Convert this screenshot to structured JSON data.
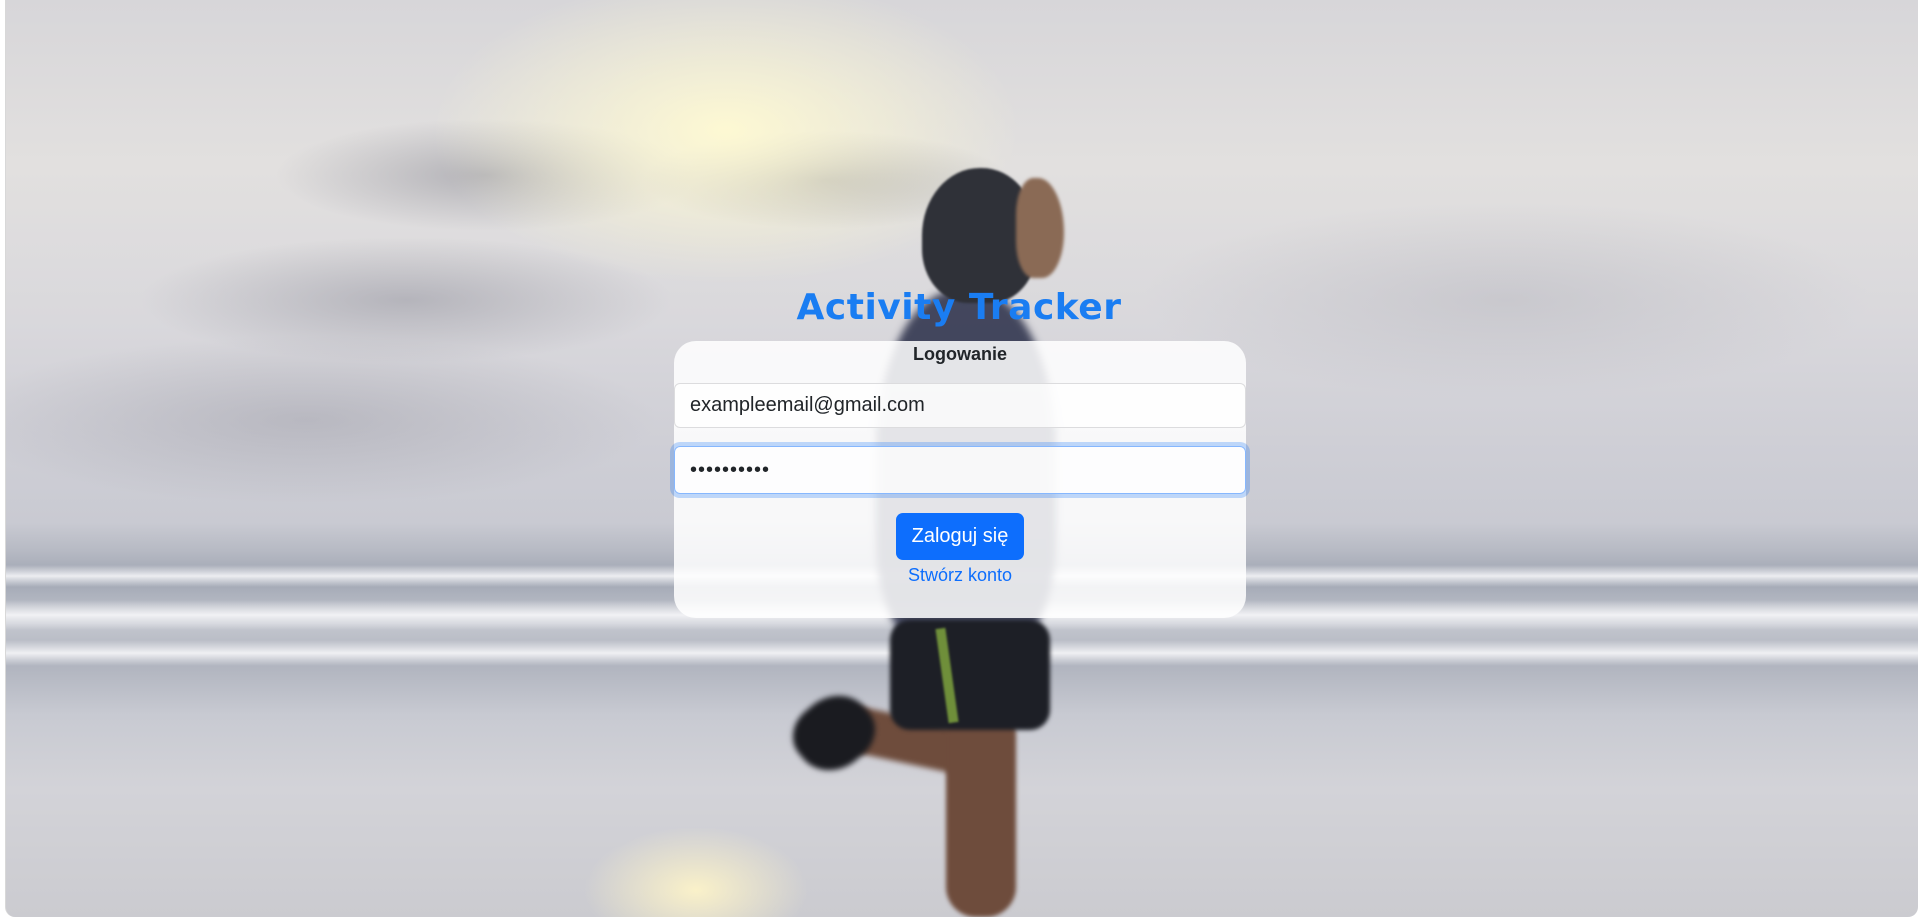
{
  "app": {
    "title": "Activity Tracker"
  },
  "login_card": {
    "heading": "Logowanie",
    "email": {
      "value": "exampleemail@gmail.com"
    },
    "password": {
      "value": "••••••••••"
    },
    "submit_label": "Zaloguj się",
    "create_account_label": "Stwórz konto"
  },
  "colors": {
    "accent": "#0d6efd",
    "title": "#1a7df2",
    "text": "#212529",
    "focus_ring": "#86b7fe"
  },
  "background": {
    "image_subject": "runner-on-beach-photo"
  }
}
